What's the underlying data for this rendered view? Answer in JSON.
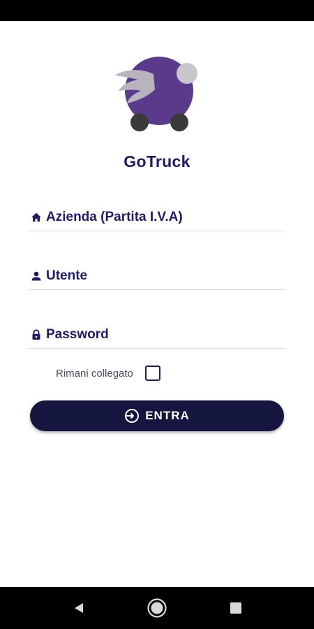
{
  "app": {
    "title": "GoTruck"
  },
  "form": {
    "company_placeholder": "Azienda (Partita I.V.A)",
    "user_placeholder": "Utente",
    "password_placeholder": "Password",
    "remember_label": "Rimani collegato",
    "remember_checked": false,
    "login_label": "ENTRA"
  },
  "icons": {
    "company": "home-icon",
    "user": "person-icon",
    "password": "lock-icon",
    "login": "login-arrow-icon",
    "nav_back": "back-triangle-icon",
    "nav_home": "home-circle-icon",
    "nav_recents": "recents-square-icon"
  },
  "colors": {
    "primary_text": "#1f1d6b",
    "button_bg": "#14163f",
    "logo_purple": "#5b3a8c",
    "logo_wheel": "#3a3a3a",
    "logo_wing": "#b8b4be"
  }
}
